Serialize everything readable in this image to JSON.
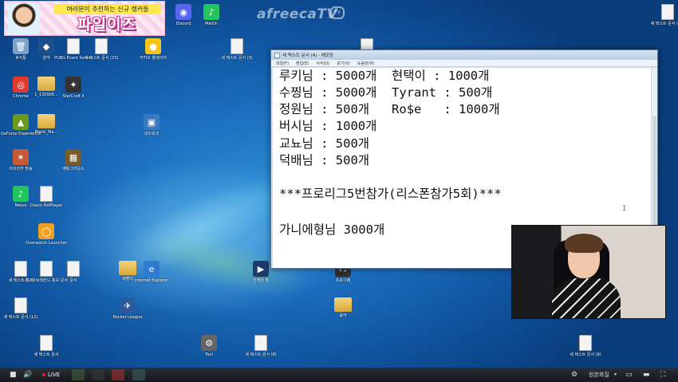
{
  "banner": {
    "subtitle": "여러분이 추천하는 신규 랭커들",
    "title": "파일이즈"
  },
  "watermark": {
    "text": "afreecaTV",
    "badge": "TV"
  },
  "desktop_icons": [
    {
      "name": "discord-icon",
      "label": "Discord",
      "kind": "app",
      "color": "#5865f2",
      "glyph": "◉"
    },
    {
      "name": "melon-icon",
      "label": "MelOn",
      "kind": "app",
      "color": "#23c55e",
      "glyph": "♪"
    },
    {
      "name": "recycle-bin-icon",
      "label": "휴지통",
      "kind": "app",
      "color": "#7da3c8",
      "glyph": "🗑"
    },
    {
      "name": "ahnlab-icon",
      "label": "알약",
      "kind": "app",
      "color": "#1f4f8b",
      "glyph": "◆"
    },
    {
      "name": "pubg-server-icon",
      "label": "PUBG Event Server",
      "kind": "doc",
      "color": "#fff",
      "glyph": ""
    },
    {
      "name": "new-text-doc-icon",
      "label": "새 텍스트 문서 (23)",
      "kind": "doc",
      "color": "#fff",
      "glyph": ""
    },
    {
      "name": "kakao-player-icon",
      "label": "카카오 플레이어",
      "kind": "app",
      "color": "#f5c518",
      "glyph": "●"
    },
    {
      "name": "new-text-doc-icon-2",
      "label": "새 텍스트 문서 (3)",
      "kind": "doc",
      "color": "#fff",
      "glyph": ""
    },
    {
      "name": "new-text-doc-icon-3",
      "label": "새 텍스트 문서 (4)",
      "kind": "doc",
      "color": "#fff",
      "glyph": ""
    },
    {
      "name": "new-text-doc-icon-4",
      "label": "새 텍스트 문서 (13)",
      "kind": "doc",
      "color": "#fff",
      "glyph": ""
    },
    {
      "name": "chrome-icon",
      "label": "Chrome",
      "kind": "app",
      "color": "#e23a2e",
      "glyph": "◎"
    },
    {
      "name": "folder-icon",
      "label": "1_135905...",
      "kind": "folder",
      "color": "#e0b44a",
      "glyph": ""
    },
    {
      "name": "starcraft-icon",
      "label": "StarCraft II",
      "kind": "app",
      "color": "#333",
      "glyph": "✦"
    },
    {
      "name": "geforce-icon",
      "label": "GeForce Experience",
      "kind": "app",
      "color": "#6a9b1e",
      "glyph": "▲"
    },
    {
      "name": "folder-icon-2",
      "label": "Marbl_Ma...",
      "kind": "folder",
      "color": "#e0b44a",
      "glyph": ""
    },
    {
      "name": "network-icon",
      "label": "네트워크",
      "kind": "app",
      "color": "#3a78c4",
      "glyph": "▣"
    },
    {
      "name": "afreeca-icon",
      "label": "아프리카 방송",
      "kind": "app",
      "color": "#c65a35",
      "glyph": "✶"
    },
    {
      "name": "pubg-icon",
      "label": "배틀그라운드",
      "kind": "app",
      "color": "#7a5a2a",
      "glyph": "▦"
    },
    {
      "name": "melon-icon-2",
      "label": "Melon",
      "kind": "app",
      "color": "#23c55e",
      "glyph": "♪"
    },
    {
      "name": "daum-potplayer-icon",
      "label": "Daum PotPlayer",
      "kind": "doc",
      "color": "#fff",
      "glyph": ""
    },
    {
      "name": "overwatch-icon",
      "label": "Overwatch Launcher",
      "kind": "app",
      "color": "#f0a020",
      "glyph": "◯"
    },
    {
      "name": "new-text-doc-icon-5",
      "label": "새 텍스트 문서",
      "kind": "doc",
      "color": "#fff",
      "glyph": ""
    },
    {
      "name": "new-text-doc-icon-6",
      "label": "리그오브레전드 홍보 문서",
      "kind": "doc",
      "color": "#fff",
      "glyph": ""
    },
    {
      "name": "doc-icon",
      "label": "문서",
      "kind": "doc",
      "color": "#fff",
      "glyph": ""
    },
    {
      "name": "folder-icon-3",
      "label": "새폴더",
      "kind": "folder",
      "color": "#e0b44a",
      "glyph": ""
    },
    {
      "name": "ie-icon",
      "label": "Internet Explorer",
      "kind": "app",
      "color": "#2f7bd1",
      "glyph": "e"
    },
    {
      "name": "ps-icon",
      "label": "인게임 툴",
      "kind": "app",
      "color": "#1e3b6a",
      "glyph": "▶"
    },
    {
      "name": "ts-icon",
      "label": "프로그램",
      "kind": "app",
      "color": "#2f2f2f",
      "glyph": "⛶"
    },
    {
      "name": "rocket-league-icon",
      "label": "Rocket League",
      "kind": "app",
      "color": "#2c5aa0",
      "glyph": "✈"
    },
    {
      "name": "folder-icon-4",
      "label": "음악",
      "kind": "folder",
      "color": "#e0b44a",
      "glyph": ""
    },
    {
      "name": "new-text-doc-icon-7",
      "label": "새 텍스트 문서",
      "kind": "doc",
      "color": "#fff",
      "glyph": ""
    },
    {
      "name": "tool-icon",
      "label": "Tool",
      "kind": "app",
      "color": "#666",
      "glyph": "⚙"
    },
    {
      "name": "new-text-doc-icon-8",
      "label": "새 텍스트 문서 (8)",
      "kind": "doc",
      "color": "#fff",
      "glyph": ""
    },
    {
      "name": "new-text-doc-icon-9",
      "label": "새 텍스트 문서 (8)",
      "kind": "doc",
      "color": "#fff",
      "glyph": ""
    },
    {
      "name": "new-text-doc-icon-10",
      "label": "새 텍스트 문서 (12)",
      "kind": "doc",
      "color": "#fff",
      "glyph": ""
    }
  ],
  "notepad": {
    "title": "새 텍스트 문서 (4) - 메모장",
    "menu": [
      "파일(F)",
      "편집(E)",
      "서식(O)",
      "보기(V)",
      "도움말(H)"
    ],
    "lines": [
      "루키님 : 5000개  현택이 : 1000개",
      "수찡님 : 5000개  Tyrant : 500개",
      "정원님 : 500개   Ro$e   : 1000개",
      "버시님 : 1000개",
      "교뇨님 : 500개",
      "덕배님 : 500개",
      "",
      "***프로리그5번참가(리스폰참가5회)***",
      "",
      "가니에형님 3000개"
    ],
    "cursor": "I"
  },
  "taskbar": {
    "live_label": "LIVE",
    "quality_label": "원본화질"
  }
}
